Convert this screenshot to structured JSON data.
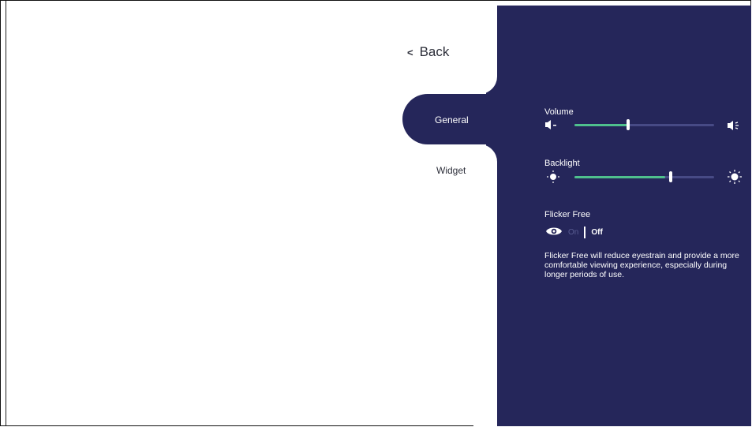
{
  "nav": {
    "back_label": "Back",
    "tabs": [
      {
        "label": "General",
        "active": true
      },
      {
        "label": "Widget",
        "active": false
      }
    ]
  },
  "settings": {
    "volume": {
      "label": "Volume",
      "level": 0.4,
      "icons": [
        "volume-down-icon",
        "volume-up-icon"
      ]
    },
    "backlight": {
      "label": "Backlight",
      "level": 0.7,
      "icons": [
        "brightness-low-icon",
        "brightness-high-icon"
      ]
    },
    "flicker_free": {
      "label": "Flicker Free",
      "on_label": "On",
      "off_label": "Off",
      "state": "Off",
      "description": "Flicker Free will reduce eyestrain and provide a more comfortable viewing experience, especially during longer periods of use."
    }
  },
  "colors": {
    "panel": "#25265a",
    "slider_fill": "#4fc08d",
    "slider_track": "#474a85",
    "text_dark": "#2d2f3a"
  }
}
